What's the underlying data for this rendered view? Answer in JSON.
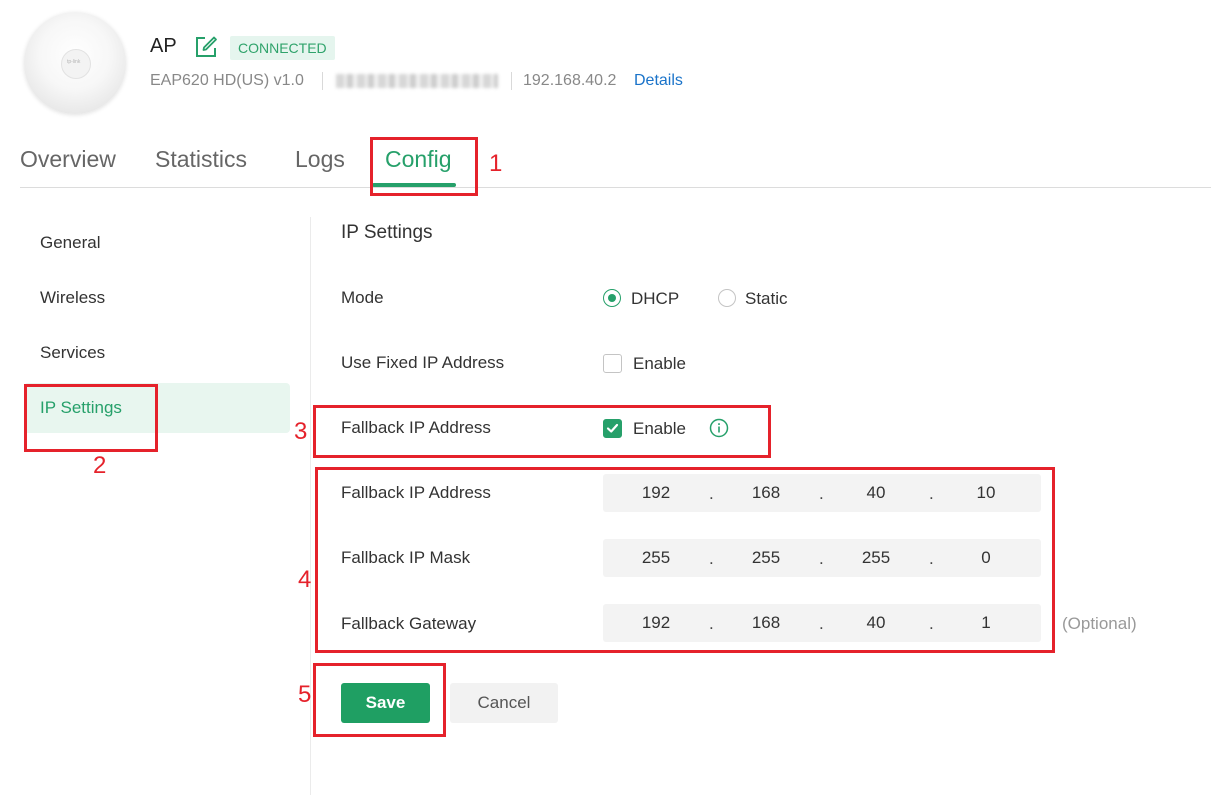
{
  "device": {
    "name": "AP",
    "status": "CONNECTED",
    "model": "EAP620 HD(US) v1.0",
    "ip": "192.168.40.2",
    "details_link": "Details",
    "logo_text": "tp-link"
  },
  "tabs": [
    {
      "label": "Overview"
    },
    {
      "label": "Statistics"
    },
    {
      "label": "Logs"
    },
    {
      "label": "Config",
      "active": true
    }
  ],
  "sidebar": {
    "items": [
      {
        "label": "General"
      },
      {
        "label": "Wireless"
      },
      {
        "label": "Services"
      },
      {
        "label": "IP Settings",
        "active": true
      }
    ]
  },
  "ip_settings": {
    "title": "IP Settings",
    "mode": {
      "label": "Mode",
      "options": [
        "DHCP",
        "Static"
      ],
      "selected": "DHCP"
    },
    "fixed_ip": {
      "label": "Use Fixed IP Address",
      "option": "Enable",
      "checked": false
    },
    "fallback": {
      "label": "Fallback IP Address",
      "option": "Enable",
      "checked": true
    },
    "fallback_ip": {
      "label": "Fallback IP Address",
      "octets": [
        "192",
        "168",
        "40",
        "10"
      ]
    },
    "fallback_mask": {
      "label": "Fallback IP Mask",
      "octets": [
        "255",
        "255",
        "255",
        "0"
      ]
    },
    "fallback_gateway": {
      "label": "Fallback Gateway",
      "octets": [
        "192",
        "168",
        "40",
        "1"
      ],
      "hint": "(Optional)"
    },
    "dot": "."
  },
  "buttons": {
    "save": "Save",
    "cancel": "Cancel"
  },
  "annotations": {
    "labels": [
      "1",
      "2",
      "3",
      "4",
      "5"
    ]
  },
  "colors": {
    "accent": "#26a06a",
    "annotation": "#e5222b",
    "link": "#1a73c9"
  },
  "icons": {
    "edit": "edit-icon",
    "info": "info-icon",
    "check": "check-icon"
  }
}
